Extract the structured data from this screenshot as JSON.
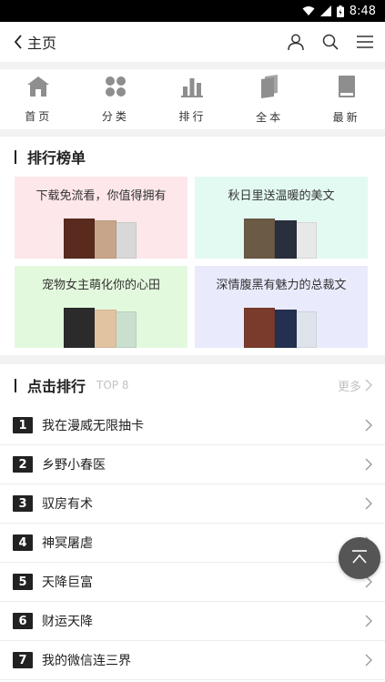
{
  "status_bar": {
    "time": "8:48"
  },
  "header": {
    "back_label": "主页"
  },
  "nav": [
    {
      "label": "首页",
      "icon": "home-icon"
    },
    {
      "label": "分类",
      "icon": "category-icon"
    },
    {
      "label": "排行",
      "icon": "rank-chart-icon"
    },
    {
      "label": "全本",
      "icon": "complete-books-icon"
    },
    {
      "label": "最新",
      "icon": "latest-book-icon"
    }
  ],
  "ranking_board": {
    "title": "排行榜单",
    "cards": [
      {
        "title": "下载免流看，你值得拥有",
        "bg": "#fde7ea",
        "covers": [
          "#5a2a1e",
          "#c7a58a",
          "#d8d8d8"
        ]
      },
      {
        "title": "秋日里送温暖的美文",
        "bg": "#e3faf3",
        "covers": [
          "#6b5a44",
          "#2a2f3e",
          "#e8e8e8"
        ]
      },
      {
        "title": "宠物女主萌化你的心田",
        "bg": "#e3f9dd",
        "covers": [
          "#2b2b2b",
          "#e2c3a1",
          "#c9e0cf"
        ]
      },
      {
        "title": "深情腹黑有魅力的总裁文",
        "bg": "#e9eafc",
        "covers": [
          "#7a3b2c",
          "#24304f",
          "#dfe4ec"
        ]
      }
    ]
  },
  "click_ranking": {
    "title": "点击排行",
    "sub": "TOP 8",
    "more": "更多",
    "items": [
      {
        "num": "1",
        "name": "我在漫威无限抽卡"
      },
      {
        "num": "2",
        "name": "乡野小春医"
      },
      {
        "num": "3",
        "name": "驭房有术"
      },
      {
        "num": "4",
        "name": "神冥屠虐"
      },
      {
        "num": "5",
        "name": "天降巨富"
      },
      {
        "num": "6",
        "name": "财运天降"
      },
      {
        "num": "7",
        "name": "我的微信连三界"
      }
    ]
  },
  "colors": {
    "accent": "#222222",
    "band": "#f2f2f2",
    "fab": "#555555"
  }
}
